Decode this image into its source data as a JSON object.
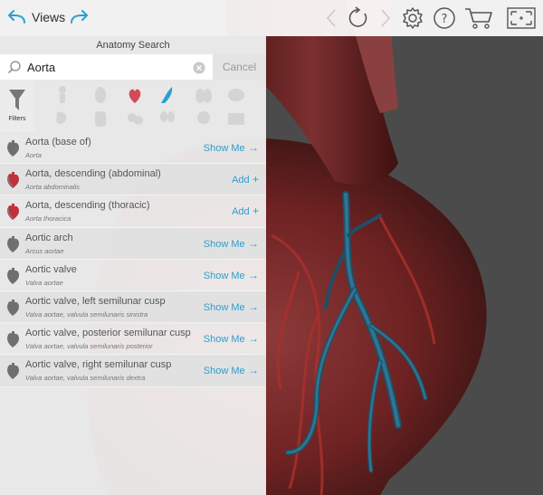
{
  "toolbar": {
    "views_label": "Views",
    "icons": [
      "undo-arrow-icon",
      "redo-arrow-icon",
      "chevron-left-icon",
      "reset-rotate-icon",
      "chevron-right-icon",
      "gear-icon",
      "help-icon",
      "cart-icon",
      "fit-screen-icon"
    ]
  },
  "panel": {
    "title": "Anatomy Search",
    "search_value": "Aorta",
    "cancel_label": "Cancel",
    "filters_label": "Filters"
  },
  "results": [
    {
      "name": "Aorta (base of)",
      "latin": "Aorta",
      "action": "Show Me",
      "action_icon": "arrow-right-icon",
      "color": "grey"
    },
    {
      "name": "Aorta, descending (abdominal)",
      "latin": "Aorta abdominalis",
      "action": "Add",
      "action_icon": "plus-icon",
      "color": "red"
    },
    {
      "name": "Aorta, descending (thoracic)",
      "latin": "Aorta thoracica",
      "action": "Add",
      "action_icon": "plus-icon",
      "color": "red"
    },
    {
      "name": "Aortic arch",
      "latin": "Arcus aortae",
      "action": "Show Me",
      "action_icon": "arrow-right-icon",
      "color": "grey"
    },
    {
      "name": "Aortic valve",
      "latin": "Valva aortae",
      "action": "Show Me",
      "action_icon": "arrow-right-icon",
      "color": "grey"
    },
    {
      "name": "Aortic valve, left semilunar cusp",
      "latin": "Valva aortae, valvula semilunaris sinistra",
      "action": "Show Me",
      "action_icon": "arrow-right-icon",
      "color": "grey"
    },
    {
      "name": "Aortic valve, posterior semilunar cusp",
      "latin": "Valva aortae, valvula semilunaris posterior",
      "action": "Show Me",
      "action_icon": "arrow-right-icon",
      "color": "grey"
    },
    {
      "name": "Aortic valve, right semilunar cusp",
      "latin": "Valva aortae, valvula semilunaris dextra",
      "action": "Show Me",
      "action_icon": "arrow-right-icon",
      "color": "grey"
    }
  ],
  "colors": {
    "accent": "#2a9fd0",
    "heart_grey": "#6f6f6f",
    "heart_red": "#c0323a"
  }
}
